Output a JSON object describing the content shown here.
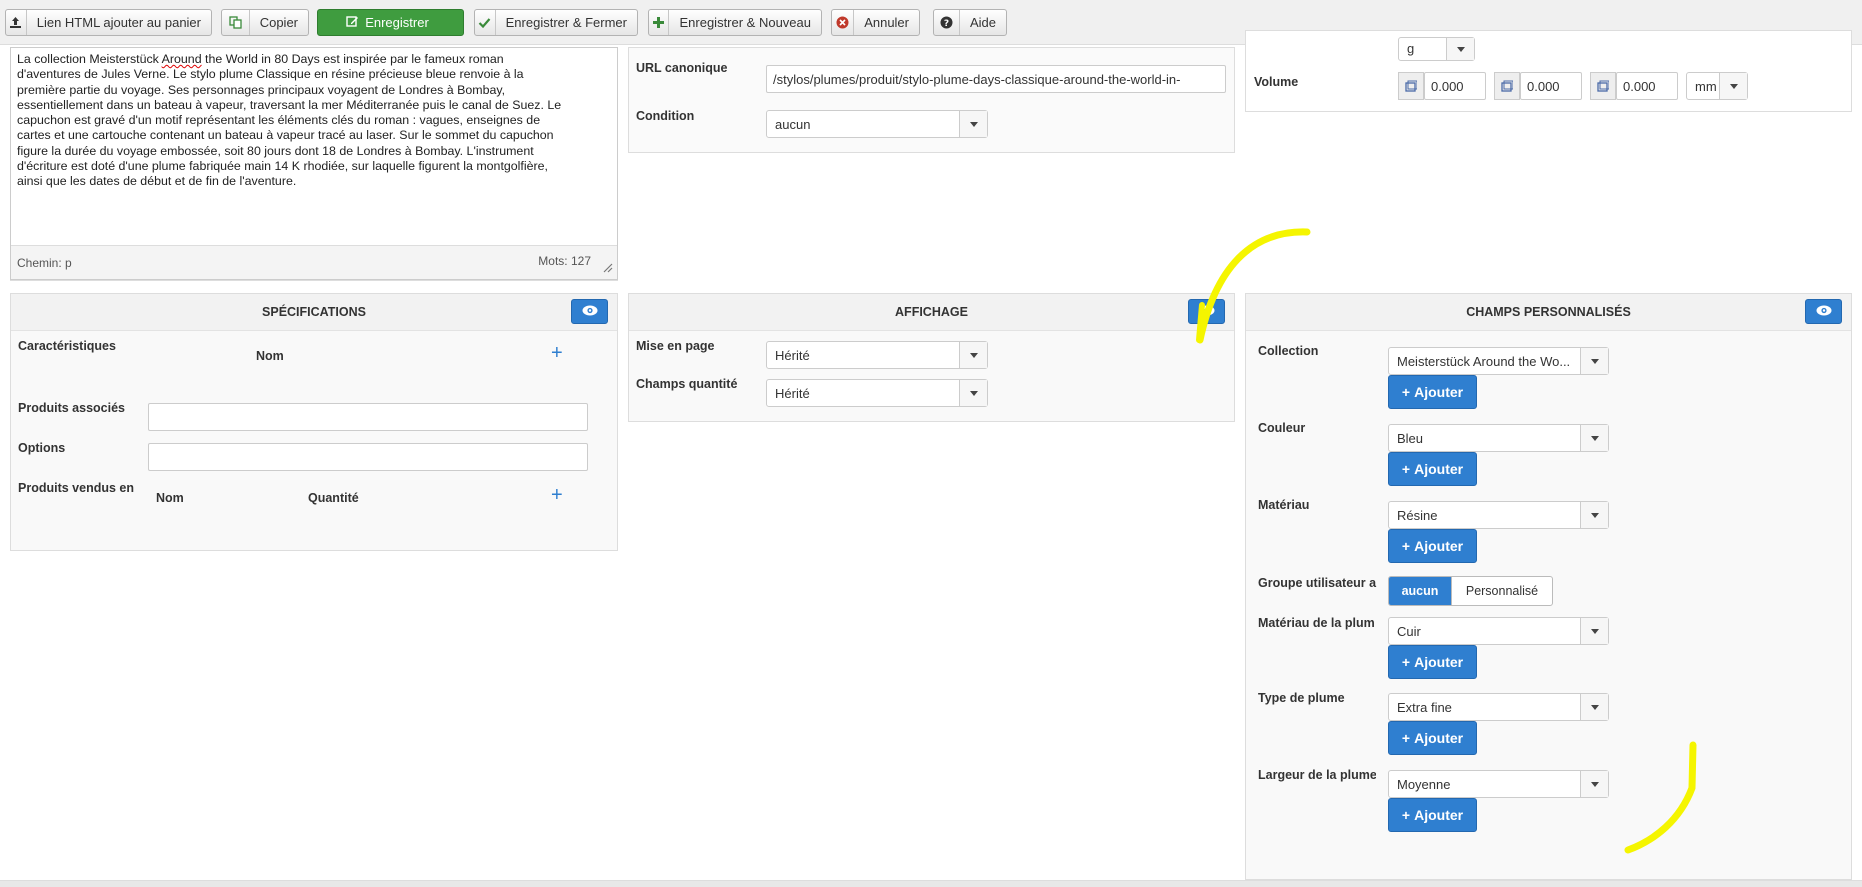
{
  "toolbar": {
    "html_link_label": "Lien HTML ajouter au panier",
    "copy_label": "Copier",
    "save_label": "Enregistrer",
    "save_close_label": "Enregistrer & Fermer",
    "save_new_label": "Enregistrer & Nouveau",
    "cancel_label": "Annuler",
    "help_label": "Aide",
    "colors": {
      "save_green": "#3f9c3f",
      "cancel_red": "#c0392b"
    }
  },
  "editor": {
    "line1_start": "La collection Meisterstück ",
    "line1_misspelled": "Around",
    "line1_end": " the World in 80 Days est inspirée par le fameux roman",
    "lines": [
      "d'aventures de Jules Verne. Le stylo plume Classique en résine précieuse bleue renvoie à la",
      "première partie du voyage. Ses personnages principaux voyagent de Londres à Bombay,",
      "essentiellement dans un bateau à vapeur, traversant la mer Méditerranée puis le canal de Suez. Le",
      "capuchon est gravé d'un motif représentant les éléments clés du roman : vagues, enseignes de",
      "cartes et une cartouche contenant un bateau à vapeur tracé au laser. Sur le sommet du capuchon",
      "figure la durée du voyage embossée, soit 80 jours dont 18 de Londres à Bombay. L'instrument",
      "d'écriture est doté d'une plume fabriquée main 14 K rhodiée, sur laquelle figurent la montgolfière,",
      "ainsi que les dates de début et de fin de l'aventure."
    ],
    "path_label": "Chemin: p",
    "word_count": "Mots: 127"
  },
  "seo": {
    "canonical_label": "URL canonique",
    "canonical_value": "/stylos/plumes/produit/stylo-plume-days-classique-around-the-world-in-",
    "condition_label": "Condition",
    "condition_value": "aucun"
  },
  "dimensions": {
    "weight_unit": "g",
    "volume_label": "Volume",
    "volume_values": [
      "0.000",
      "0.000",
      "0.000"
    ],
    "volume_unit": "mm"
  },
  "specs": {
    "title": "SPÉCIFICATIONS",
    "characteristics_label": "Caractéristiques",
    "name_col": "Nom",
    "related_label": "Produits associés",
    "options_label": "Options",
    "sold_in_label": "Produits vendus en",
    "sold_name_col": "Nom",
    "sold_qty_col": "Quantité"
  },
  "display": {
    "title": "AFFICHAGE",
    "layout_label": "Mise en page",
    "layout_value": "Hérité",
    "qty_label": "Champs quantité",
    "qty_value": "Hérité"
  },
  "custom": {
    "title": "CHAMPS PERSONNALISÉS",
    "add_label": "Ajouter",
    "collection_label": "Collection",
    "collection_value": "Meisterstück Around the Wo...",
    "color_label": "Couleur",
    "color_value": "Bleu",
    "material_label": "Matériau",
    "material_value": "Résine",
    "usergroup_label": "Groupe utilisateur a",
    "usergroup_opt1": "aucun",
    "usergroup_opt2": "Personnalisé",
    "nib_material_label": "Matériau de la plum",
    "nib_material_value": "Cuir",
    "nib_type_label": "Type de plume",
    "nib_type_value": "Extra fine",
    "nib_width_label": "Largeur de la plume",
    "nib_width_value": "Moyenne"
  },
  "annotation_color": "#f5f500"
}
